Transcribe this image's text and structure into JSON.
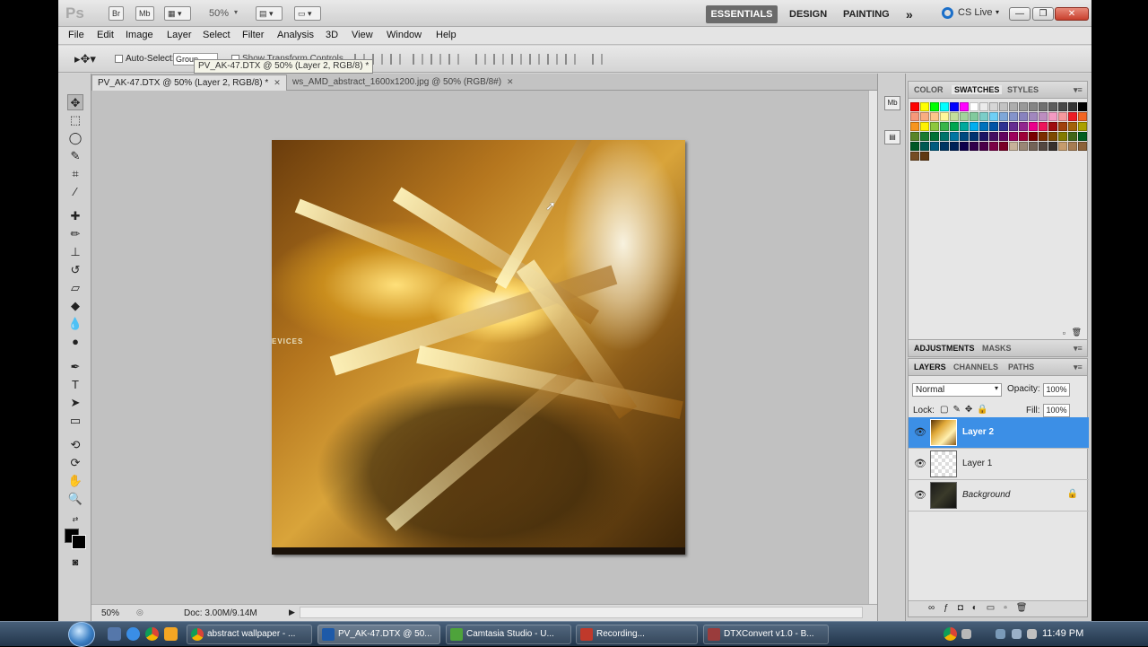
{
  "app": {
    "logo": "Ps",
    "bridge_label": "Br",
    "minibridge_label": "Mb",
    "zoom": "50%",
    "workspaces": [
      "ESSENTIALS",
      "DESIGN",
      "PAINTING"
    ],
    "more_workspaces": "»",
    "cs_live": "CS Live",
    "window_controls": [
      "—",
      "❐",
      "✕"
    ]
  },
  "menu": [
    "File",
    "Edit",
    "Image",
    "Layer",
    "Select",
    "Filter",
    "Analysis",
    "3D",
    "View",
    "Window",
    "Help"
  ],
  "options": {
    "auto_select_label": "Auto-Select:",
    "auto_select_value": "Group",
    "show_transform_label": "Show Transform Controls",
    "tooltip": "PV_AK-47.DTX @ 50% (Layer 2, RGB/8) *"
  },
  "documents": {
    "tabs": [
      {
        "label": "PV_AK-47.DTX @ 50% (Layer 2, RGB/8) *",
        "active": true
      },
      {
        "label": "ws_AMD_abstract_1600x1200.jpg @ 50% (RGB/8#)",
        "active": false
      }
    ],
    "close_glyph": "✕",
    "canvas_overlay_text": "EVICES"
  },
  "status": {
    "zoom": "50%",
    "doc": "Doc: 3.00M/9.14M"
  },
  "panels": {
    "top_tabs": [
      "COLOR",
      "SWATCHES",
      "STYLES"
    ],
    "active_top_tab": "SWATCHES",
    "adjust_tabs": [
      "ADJUSTMENTS",
      "MASKS"
    ],
    "layer_tabs": [
      "LAYERS",
      "CHANNELS",
      "PATHS"
    ],
    "blend_mode": "Normal",
    "opacity_label": "Opacity:",
    "opacity_value": "100%",
    "lock_label": "Lock:",
    "fill_label": "Fill:",
    "fill_value": "100%",
    "layers": [
      {
        "name": "Layer 2",
        "selected": true
      },
      {
        "name": "Layer 1",
        "selected": false
      },
      {
        "name": "Background",
        "selected": false,
        "locked": true
      }
    ],
    "swatch_colors": [
      "#ff0000",
      "#ffff00",
      "#00ff00",
      "#00ffff",
      "#0000ff",
      "#ff00ff",
      "#ffffff",
      "#ebebeb",
      "#d6d6d6",
      "#c2c2c2",
      "#adadad",
      "#999999",
      "#858585",
      "#707070",
      "#5c5c5c",
      "#474747",
      "#333333",
      "#000000",
      "#f7977a",
      "#f9ad81",
      "#fdc68a",
      "#fff79a",
      "#c4df9b",
      "#a2d39c",
      "#82ca9d",
      "#7bcdc8",
      "#6ecff6",
      "#7ea7d8",
      "#8493ca",
      "#8882be",
      "#a187be",
      "#bc8dbf",
      "#f49ac2",
      "#f6989d",
      "#ed1c24",
      "#f26522",
      "#f7941d",
      "#fff200",
      "#8dc73f",
      "#39b54a",
      "#00a651",
      "#00a99d",
      "#00aeef",
      "#0072bc",
      "#0054a6",
      "#2e3192",
      "#662d91",
      "#92278f",
      "#ec008c",
      "#ed145b",
      "#9e0b0f",
      "#a0410d",
      "#a36209",
      "#aba000",
      "#598527",
      "#1a7b30",
      "#007236",
      "#00746b",
      "#0076a3",
      "#004a80",
      "#003471",
      "#1b1464",
      "#440e62",
      "#630460",
      "#9e005d",
      "#9e0039",
      "#790000",
      "#7b2e00",
      "#7d4900",
      "#827b00",
      "#406618",
      "#005e20",
      "#005826",
      "#005952",
      "#005b7f",
      "#003663",
      "#002157",
      "#0d004c",
      "#32004b",
      "#4b0049",
      "#7b0046",
      "#7a0026",
      "#c7b299",
      "#998675",
      "#736357",
      "#534741",
      "#37302d",
      "#c69c6d",
      "#a67c52",
      "#8c6239",
      "#754c24",
      "#603913"
    ]
  },
  "taskbar": {
    "tasks": [
      {
        "label": "abstract wallpaper - ...",
        "color": "#4a8cd6"
      },
      {
        "label": "PV_AK-47.DTX @ 50...",
        "color": "#1e5aa8"
      },
      {
        "label": "Camtasia Studio - U...",
        "color": "#4ea33b"
      },
      {
        "label": "Recording...",
        "color": "#c0392b"
      },
      {
        "label": "DTXConvert v1.0 - B...",
        "color": "#9a3c3c"
      }
    ],
    "clock": "11:49 PM"
  }
}
